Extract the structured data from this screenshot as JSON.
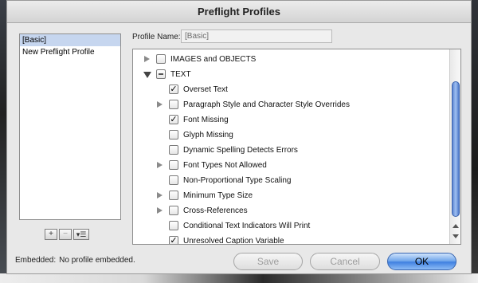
{
  "dialog": {
    "title": "Preflight Profiles"
  },
  "profiles": {
    "items": [
      "[Basic]",
      "New Preflight Profile"
    ],
    "selected_index": 0
  },
  "list_tools": {
    "add_glyph": "+",
    "remove_glyph": "−",
    "menu_glyph": "▾☰",
    "icons": [
      "add-profile-icon",
      "remove-profile-icon",
      "profile-menu-icon"
    ]
  },
  "embedded": {
    "label": "Embedded:",
    "value": "No profile embedded."
  },
  "profile_name": {
    "label": "Profile Name:",
    "value": "[Basic]"
  },
  "tree": {
    "rows": [
      {
        "label": "IMAGES and OBJECTS",
        "level": 0,
        "expander": "collapsed",
        "checked": "unchecked"
      },
      {
        "label": "TEXT",
        "level": 0,
        "expander": "expanded",
        "checked": "mixed"
      },
      {
        "label": "Overset Text",
        "level": 1,
        "expander": "none",
        "checked": "checked"
      },
      {
        "label": "Paragraph Style and Character Style Overrides",
        "level": 1,
        "expander": "collapsed",
        "checked": "unchecked"
      },
      {
        "label": "Font Missing",
        "level": 1,
        "expander": "none",
        "checked": "checked"
      },
      {
        "label": "Glyph Missing",
        "level": 1,
        "expander": "none",
        "checked": "unchecked"
      },
      {
        "label": "Dynamic Spelling Detects Errors",
        "level": 1,
        "expander": "none",
        "checked": "unchecked"
      },
      {
        "label": "Font Types Not Allowed",
        "level": 1,
        "expander": "collapsed",
        "checked": "unchecked"
      },
      {
        "label": "Non-Proportional Type Scaling",
        "level": 1,
        "expander": "none",
        "checked": "unchecked"
      },
      {
        "label": "Minimum Type Size",
        "level": 1,
        "expander": "collapsed",
        "checked": "unchecked"
      },
      {
        "label": "Cross-References",
        "level": 1,
        "expander": "collapsed",
        "checked": "unchecked"
      },
      {
        "label": "Conditional Text Indicators Will Print",
        "level": 1,
        "expander": "none",
        "checked": "unchecked"
      },
      {
        "label": "Unresolved Caption Variable",
        "level": 1,
        "expander": "none",
        "checked": "checked"
      }
    ],
    "scroll_position": 0.4
  },
  "buttons": {
    "save": "Save",
    "cancel": "Cancel",
    "ok": "OK"
  },
  "colors": {
    "selection": "#c6d6ef",
    "accent": "#3d7ee0"
  }
}
